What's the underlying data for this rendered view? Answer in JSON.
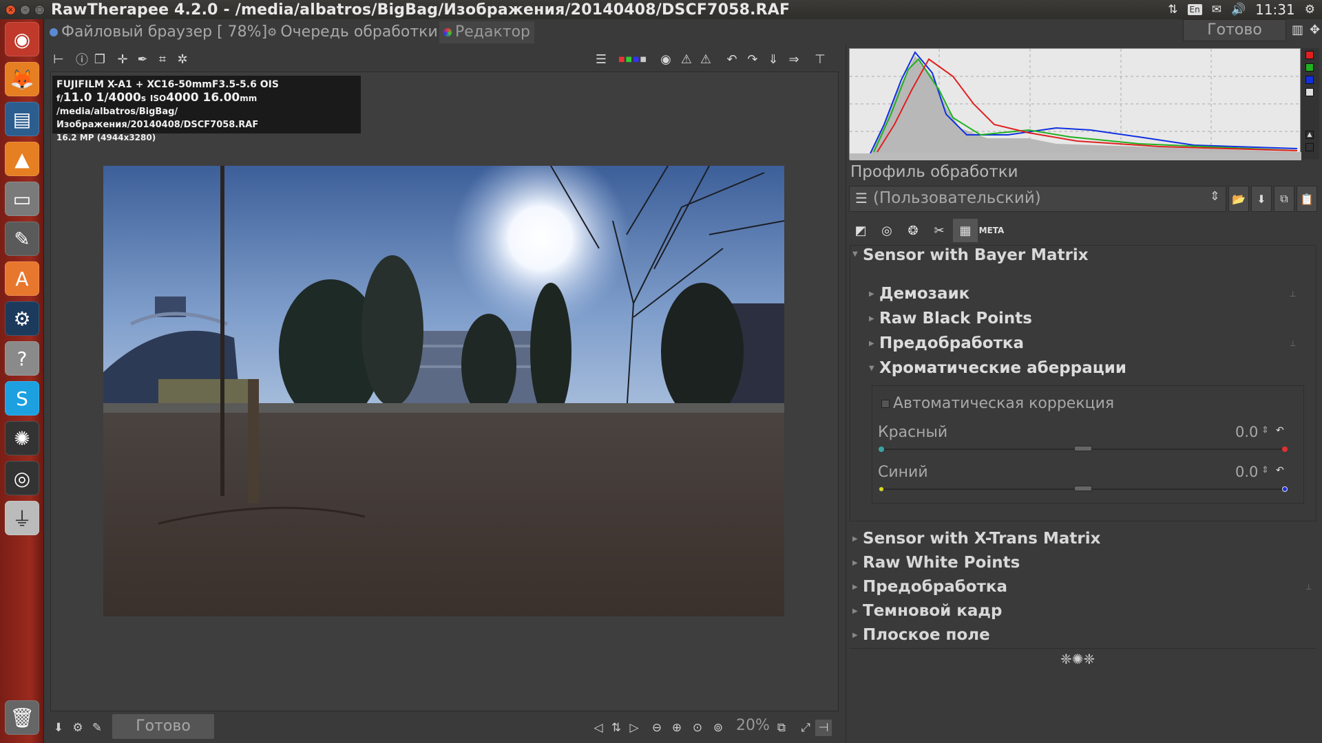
{
  "window": {
    "title": "RawTherapee 4.2.0 - /media/albatros/BigBag/Изображения/20140408/DSCF7058.RAF"
  },
  "tray": {
    "keyboard": "En",
    "time": "11:31"
  },
  "tabs": [
    {
      "label": "Файловый браузер [ 78%]"
    },
    {
      "label": "Очередь обработки"
    },
    {
      "label": "Редактор"
    }
  ],
  "queue_status": "Готово",
  "exif": {
    "camera": "FUJIFILM X-A1 + XC16-50mmF3.5-5.6 OIS",
    "aperture": "11.0",
    "shutter": "1/4000",
    "iso": "4000",
    "focal": "16.00",
    "path": "/media/albatros/BigBag/Изображения/20140408/DSCF7058.RAF",
    "size": "16.2 MP (4944x3280)",
    "f_prefix": "f/",
    "s_suffix": "s",
    "iso_prefix": "ISO",
    "mm_suffix": "mm"
  },
  "bottom": {
    "status": "Готово",
    "zoom": "20%"
  },
  "profile": {
    "label": "Профиль обработки",
    "value": "(Пользовательский)"
  },
  "raw_panel": {
    "bayer": {
      "title": "Sensor with Bayer Matrix",
      "items": [
        "Демозаик",
        "Raw Black Points",
        "Предобработка",
        "Хроматические аберрации"
      ]
    },
    "ca": {
      "auto_label": "Автоматическая коррекция",
      "red_label": "Красный",
      "red_value": "0.0",
      "blue_label": "Синий",
      "blue_value": "0.0",
      "red_level": 0.5,
      "blue_level": 0.5
    },
    "other_sections": [
      "Sensor with X-Trans Matrix",
      "Raw White Points",
      "Предобработка",
      "Темновой кадр",
      "Плоское поле"
    ]
  },
  "colors": {
    "launcher": "#9a2a1e",
    "hist_red": "#e02020",
    "hist_green": "#20b020",
    "hist_blue": "#1030e0"
  }
}
